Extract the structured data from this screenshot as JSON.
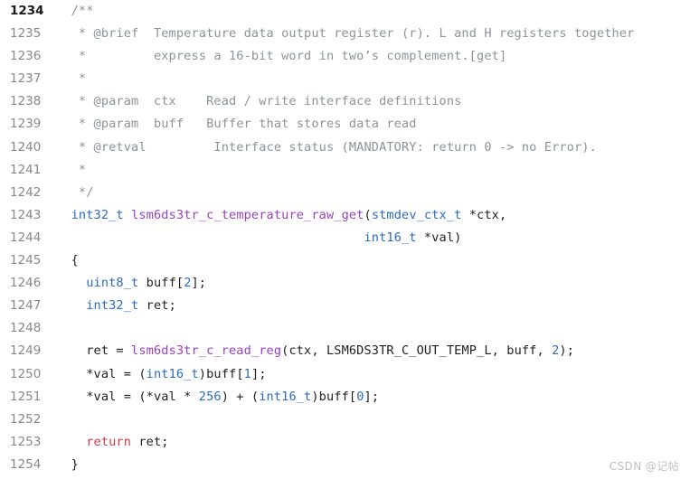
{
  "viewer": {
    "title": "lsm6ds3tr_c_temperature_raw_get",
    "language": "c",
    "first_line_number": 1234,
    "last_line_number": 1254,
    "background_color": "#ffffff",
    "colors": {
      "comment": "#8c9399",
      "type": "#2b6bbf",
      "function": "#9b3fbf",
      "keyword": "#d4384a",
      "number": "#2b6bbf",
      "plain": "#1f1f1f",
      "line_number": "#888888",
      "line_number_active": "#1b1b1b",
      "watermark": "#bfbfbf"
    }
  },
  "watermark": {
    "text": "CSDN @记帖"
  },
  "lines": [
    {
      "number": "1234",
      "tokens": [
        {
          "text": "  /**",
          "kind": "comment"
        }
      ]
    },
    {
      "number": "1235",
      "tokens": [
        {
          "text": "   * @brief  Temperature data output register (r). L and H registers together",
          "kind": "comment"
        }
      ]
    },
    {
      "number": "1236",
      "tokens": [
        {
          "text": "   *         express a 16-bit word in two’s complement.[get]",
          "kind": "comment"
        }
      ]
    },
    {
      "number": "1237",
      "tokens": [
        {
          "text": "   *",
          "kind": "comment"
        }
      ]
    },
    {
      "number": "1238",
      "tokens": [
        {
          "text": "   * @param  ctx    Read / write interface definitions",
          "kind": "comment"
        }
      ]
    },
    {
      "number": "1239",
      "tokens": [
        {
          "text": "   * @param  buff   Buffer that stores data read",
          "kind": "comment"
        }
      ]
    },
    {
      "number": "1240",
      "tokens": [
        {
          "text": "   * @retval         Interface status (MANDATORY: return 0 -> no Error).",
          "kind": "comment"
        }
      ]
    },
    {
      "number": "1241",
      "tokens": [
        {
          "text": "   *",
          "kind": "comment"
        }
      ]
    },
    {
      "number": "1242",
      "tokens": [
        {
          "text": "   */",
          "kind": "comment"
        }
      ]
    },
    {
      "number": "1243",
      "tokens": [
        {
          "text": "  ",
          "kind": "plain"
        },
        {
          "text": "int32_t",
          "kind": "type"
        },
        {
          "text": " ",
          "kind": "plain"
        },
        {
          "text": "lsm6ds3tr_c_temperature_raw_get",
          "kind": "func"
        },
        {
          "text": "(",
          "kind": "plain"
        },
        {
          "text": "stmdev_ctx_t",
          "kind": "type"
        },
        {
          "text": " *ctx,",
          "kind": "plain"
        }
      ]
    },
    {
      "number": "1244",
      "tokens": [
        {
          "text": "                                         ",
          "kind": "plain"
        },
        {
          "text": "int16_t",
          "kind": "type"
        },
        {
          "text": " *val)",
          "kind": "plain"
        }
      ]
    },
    {
      "number": "1245",
      "tokens": [
        {
          "text": "  {",
          "kind": "plain"
        }
      ]
    },
    {
      "number": "1246",
      "tokens": [
        {
          "text": "    ",
          "kind": "plain"
        },
        {
          "text": "uint8_t",
          "kind": "type"
        },
        {
          "text": " buff[",
          "kind": "plain"
        },
        {
          "text": "2",
          "kind": "number"
        },
        {
          "text": "];",
          "kind": "plain"
        }
      ]
    },
    {
      "number": "1247",
      "tokens": [
        {
          "text": "    ",
          "kind": "plain"
        },
        {
          "text": "int32_t",
          "kind": "type"
        },
        {
          "text": " ret;",
          "kind": "plain"
        }
      ]
    },
    {
      "number": "1248",
      "tokens": [
        {
          "text": "",
          "kind": "plain"
        }
      ]
    },
    {
      "number": "1249",
      "tokens": [
        {
          "text": "    ret = ",
          "kind": "plain"
        },
        {
          "text": "lsm6ds3tr_c_read_reg",
          "kind": "func"
        },
        {
          "text": "(ctx, LSM6DS3TR_C_OUT_TEMP_L, buff, ",
          "kind": "plain"
        },
        {
          "text": "2",
          "kind": "number"
        },
        {
          "text": ");",
          "kind": "plain"
        }
      ]
    },
    {
      "number": "1250",
      "tokens": [
        {
          "text": "    *val = (",
          "kind": "plain"
        },
        {
          "text": "int16_t",
          "kind": "type"
        },
        {
          "text": ")buff[",
          "kind": "plain"
        },
        {
          "text": "1",
          "kind": "number"
        },
        {
          "text": "];",
          "kind": "plain"
        }
      ]
    },
    {
      "number": "1251",
      "tokens": [
        {
          "text": "    *val = (*val * ",
          "kind": "plain"
        },
        {
          "text": "256",
          "kind": "number"
        },
        {
          "text": ") + (",
          "kind": "plain"
        },
        {
          "text": "int16_t",
          "kind": "type"
        },
        {
          "text": ")buff[",
          "kind": "plain"
        },
        {
          "text": "0",
          "kind": "number"
        },
        {
          "text": "];",
          "kind": "plain"
        }
      ]
    },
    {
      "number": "1252",
      "tokens": [
        {
          "text": "",
          "kind": "plain"
        }
      ]
    },
    {
      "number": "1253",
      "tokens": [
        {
          "text": "    ",
          "kind": "plain"
        },
        {
          "text": "return",
          "kind": "keyword"
        },
        {
          "text": " ret;",
          "kind": "plain"
        }
      ]
    },
    {
      "number": "1254",
      "tokens": [
        {
          "text": "  }",
          "kind": "plain"
        }
      ]
    }
  ]
}
